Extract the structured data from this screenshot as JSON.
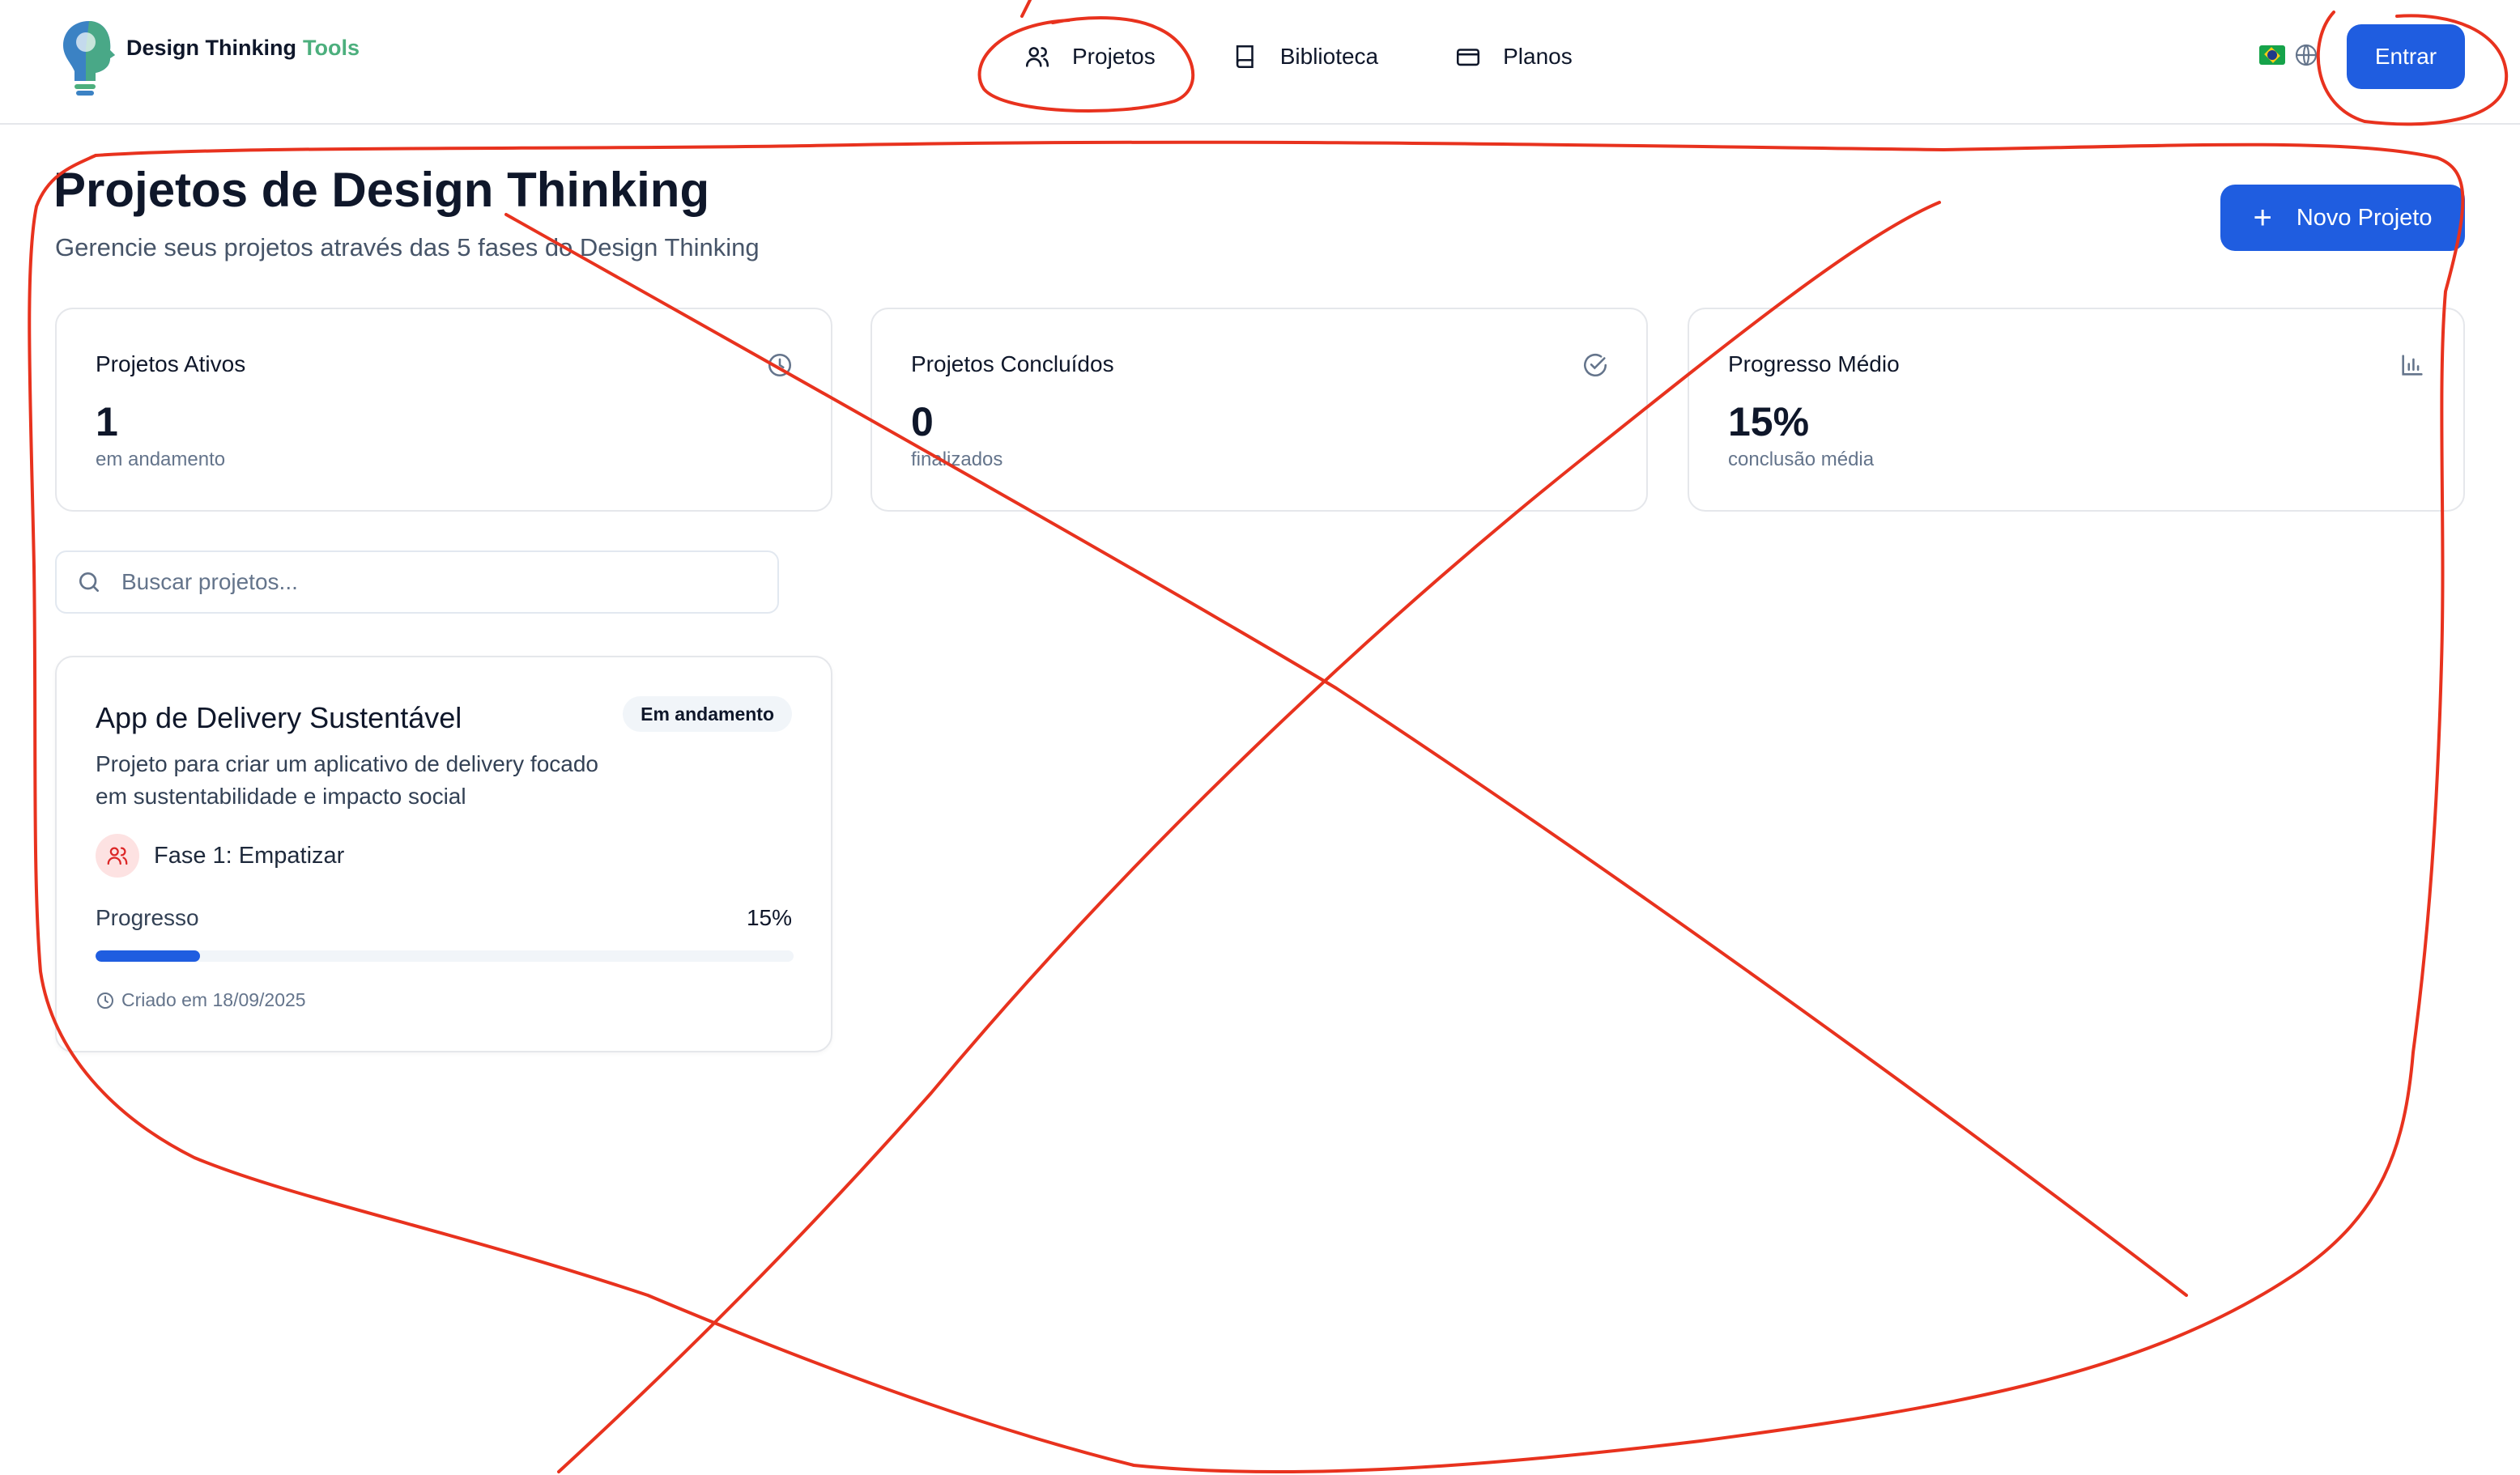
{
  "header": {
    "logo": {
      "brand": "Design Thinking",
      "accent": "Tools"
    },
    "nav": [
      {
        "label": "Projetos",
        "icon": "users-icon"
      },
      {
        "label": "Biblioteca",
        "icon": "book-icon"
      },
      {
        "label": "Planos",
        "icon": "credit-card-icon"
      }
    ],
    "language": {
      "flag": "brazil-flag",
      "icon": "globe-icon"
    },
    "login_label": "Entrar"
  },
  "page": {
    "title": "Projetos de Design Thinking",
    "subtitle": "Gerencie seus projetos através das 5 fases do Design Thinking",
    "new_project_label": "Novo Projeto"
  },
  "stats": [
    {
      "label": "Projetos Ativos",
      "value": "1",
      "sub": "em andamento",
      "icon": "clock-icon"
    },
    {
      "label": "Projetos Concluídos",
      "value": "0",
      "sub": "finalizados",
      "icon": "check-circle-icon"
    },
    {
      "label": "Progresso Médio",
      "value": "15%",
      "sub": "conclusão média",
      "icon": "bar-chart-icon"
    }
  ],
  "search": {
    "placeholder": "Buscar projetos...",
    "value": ""
  },
  "projects": [
    {
      "title": "App de Delivery Sustentável",
      "status": "Em andamento",
      "description": "Projeto para criar um aplicativo de delivery focado em sustentabilidade e impacto social",
      "phase": "Fase 1: Empatizar",
      "progress_label": "Progresso",
      "progress_text": "15%",
      "progress": 0.15,
      "created": "Criado em 18/09/2025"
    }
  ],
  "colors": {
    "primary": "#1f5de0",
    "annotation": "#e8321e",
    "brand_accent": "#4caf7d"
  }
}
